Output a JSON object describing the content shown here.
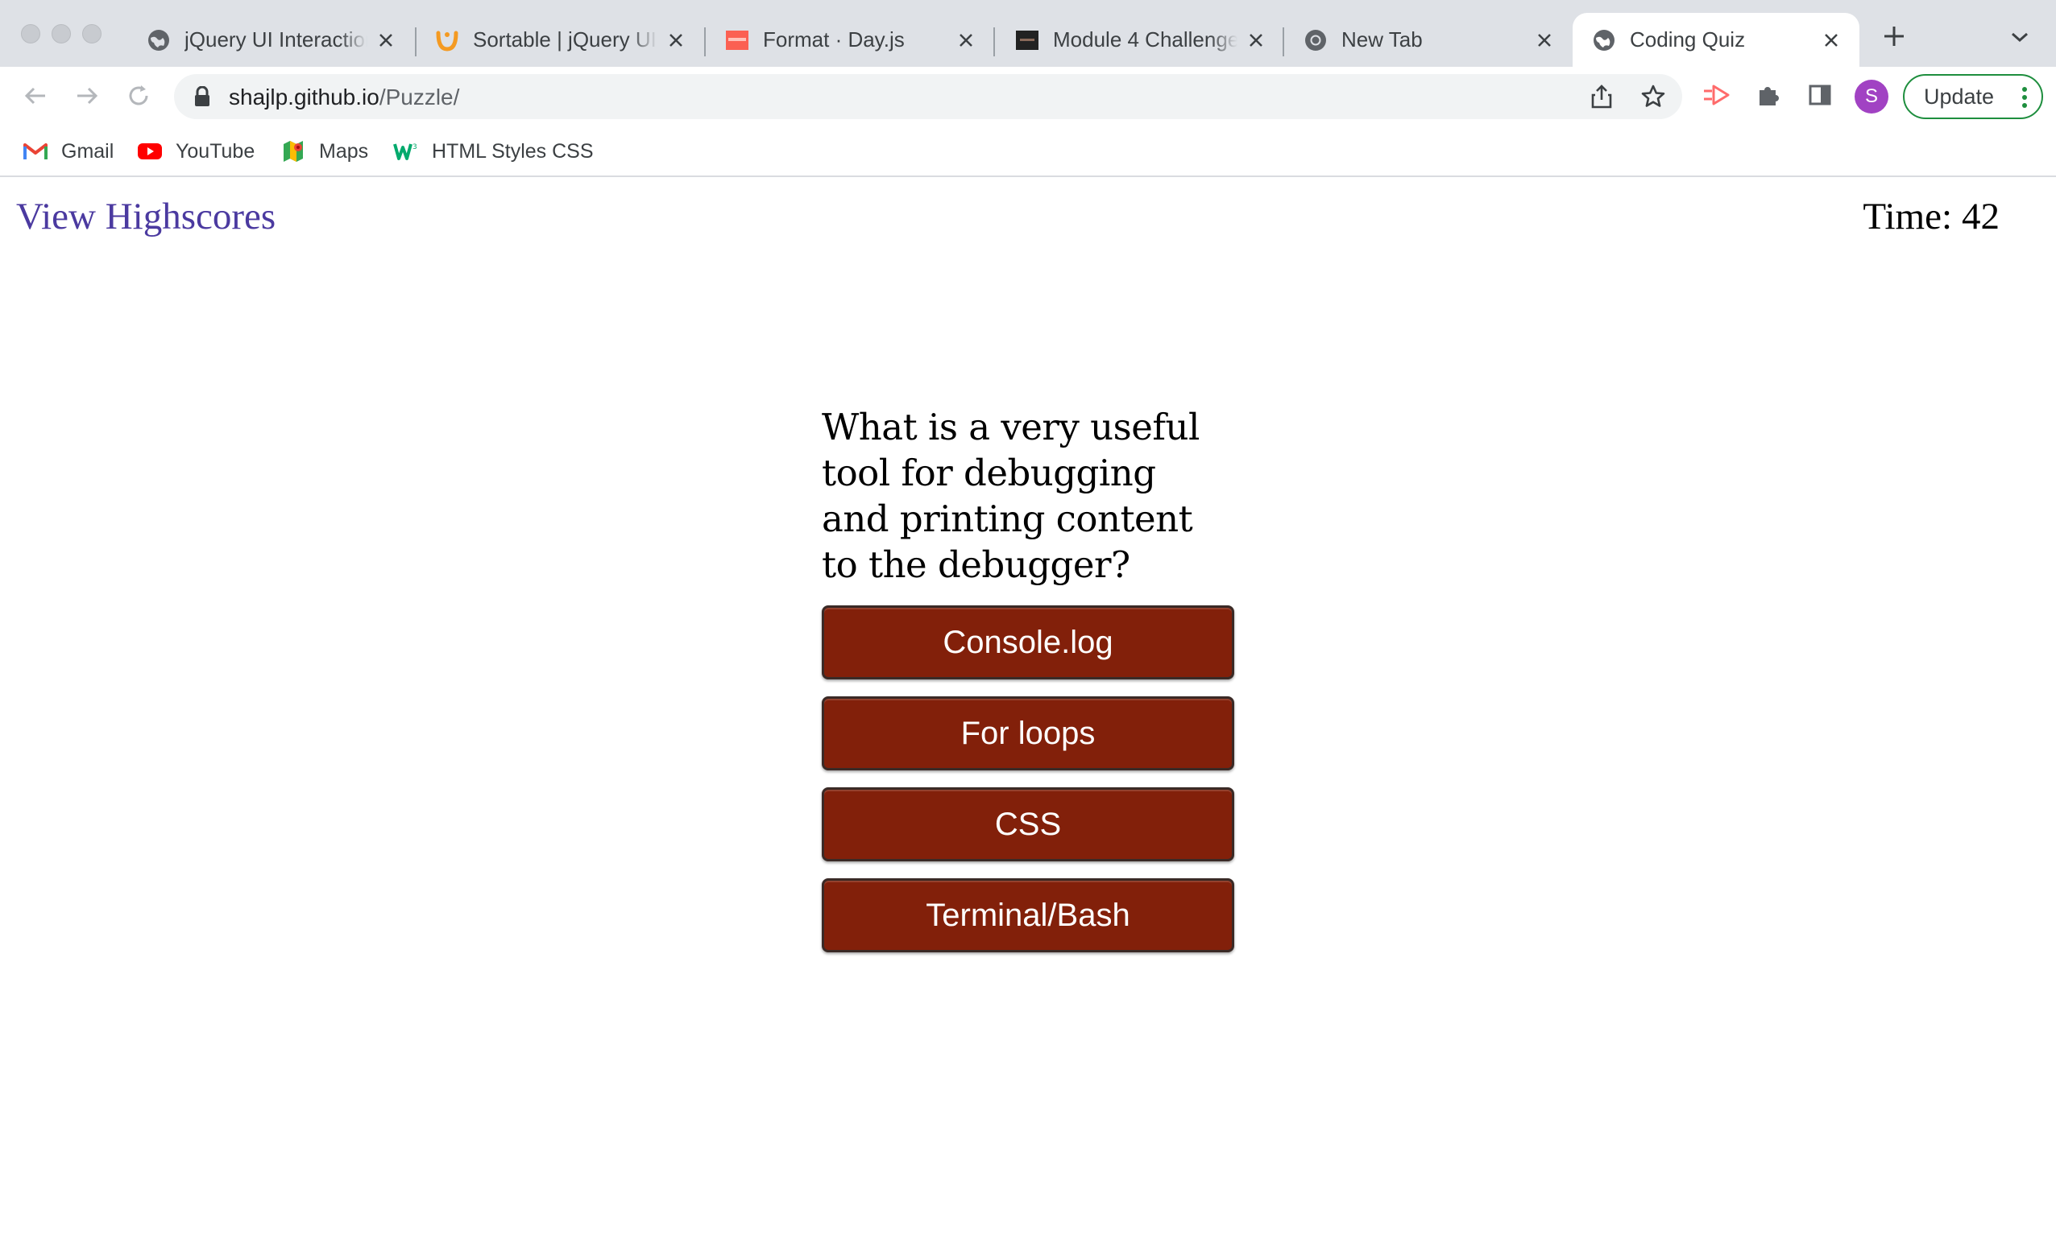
{
  "browser": {
    "tabs": [
      {
        "title": "jQuery UI Interactions",
        "favicon": "globe-icon",
        "active": false
      },
      {
        "title": "Sortable | jQuery UI",
        "favicon": "jquery-ui-icon",
        "active": false
      },
      {
        "title": "Format · Day.js",
        "favicon": "dayjs-icon",
        "active": false
      },
      {
        "title": "Module 4 Challenge",
        "favicon": "module-icon",
        "active": false
      },
      {
        "title": "New Tab",
        "favicon": "chrome-icon",
        "active": false
      },
      {
        "title": "Coding Quiz",
        "favicon": "globe-icon",
        "active": true
      }
    ],
    "url_host": "shajlp.github.io",
    "url_path": "/Puzzle/",
    "profile_initial": "S",
    "update_label": "Update",
    "bookmarks": [
      {
        "label": "Gmail",
        "icon": "gmail-icon"
      },
      {
        "label": "YouTube",
        "icon": "youtube-icon"
      },
      {
        "label": "Maps",
        "icon": "maps-icon"
      },
      {
        "label": "HTML Styles CSS",
        "icon": "w3schools-icon"
      }
    ]
  },
  "page": {
    "highscores_link": "View Highscores",
    "timer_label": "Time:",
    "timer_value": "42",
    "question": "What is a very useful tool for debugging and printing content to the debugger?",
    "answers": [
      "Console.log",
      "For loops",
      "CSS",
      "Terminal/Bash"
    ]
  },
  "colors": {
    "answer_button": "#82200a",
    "highscores_link": "#4b3aa0",
    "update_border": "#1e8e3e",
    "avatar": "#a142c3"
  }
}
